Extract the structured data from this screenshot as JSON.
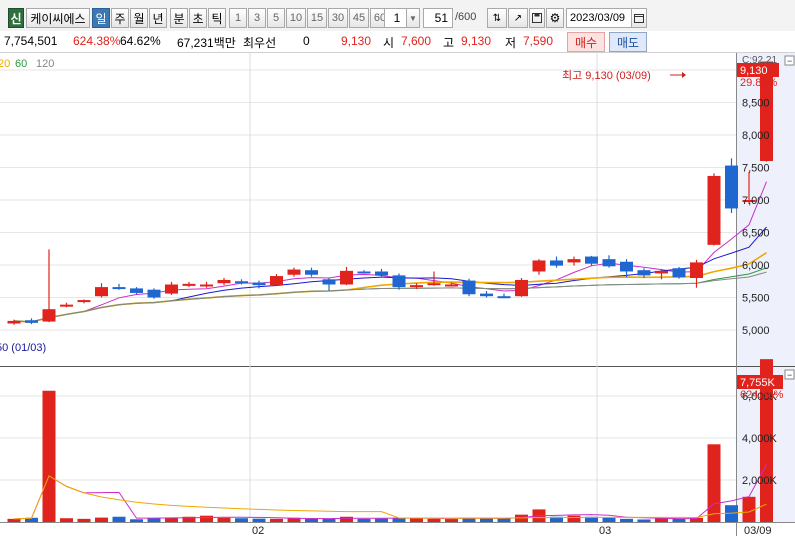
{
  "toolbar": {
    "new_badge": "신",
    "stock_name": "케이씨에스",
    "periods": [
      "일",
      "주",
      "월",
      "년"
    ],
    "unit_labels": [
      "분",
      "초",
      "틱"
    ],
    "intervals": [
      "1",
      "3",
      "5",
      "10",
      "15",
      "30",
      "45",
      "60"
    ],
    "interval_select": "1",
    "count": "51",
    "count_total": "/600",
    "date": "2023/03/09"
  },
  "info": {
    "volume": "7,754,501",
    "volume_change": "624.38%",
    "turnover": "64.62%",
    "amount": "67,231백만",
    "pref_label": "최우선",
    "pref_value": "0",
    "price": "9,130",
    "open_label": "시",
    "open": "7,600",
    "high_label": "고",
    "high": "9,130",
    "low_label": "저",
    "low": "7,590",
    "buy_button": "매수",
    "sell_button": "매도"
  },
  "legend": {
    "ma": [
      "20",
      "60",
      "120"
    ]
  },
  "annotations": {
    "high": "최고 9,130 (03/09)",
    "low": "50 (01/03)",
    "price_tag": "9,130",
    "price_pct": "29.87%",
    "price_top": "C:92.21",
    "volume_tag": "7,755K",
    "volume_pct": "624.38%"
  },
  "colors": {
    "up": "#e0231c",
    "down": "#1f66d1",
    "ma5": "#cc2ccc",
    "ma10": "#1a1acc",
    "ma20": "#f0a800",
    "ma60": "#2a9a3a",
    "ma120": "#888888",
    "panel_bg": "#ffffff",
    "axis_bg": "#eef0fb"
  },
  "chart_data": {
    "type": "candlestick",
    "price_axis": {
      "ticks": [
        "9,000",
        "8,500",
        "8,000",
        "7,500",
        "7,000",
        "6,500",
        "6,000",
        "5,500",
        "5,000"
      ],
      "tick_values": [
        9000,
        8500,
        8000,
        7500,
        7000,
        6500,
        6000,
        5500,
        5000
      ],
      "range": [
        4500,
        9700
      ]
    },
    "volume_axis": {
      "ticks": [
        "6,000K",
        "4,000K",
        "2,000K"
      ],
      "tick_values": [
        6000,
        4000,
        2000
      ],
      "range": [
        0,
        8200
      ]
    },
    "x_labels": [
      "02",
      "03",
      "03/09"
    ],
    "candles": [
      [
        5100,
        5160,
        5080,
        5140
      ],
      [
        5150,
        5180,
        5090,
        5110
      ],
      [
        5130,
        6240,
        5120,
        5320
      ],
      [
        5380,
        5420,
        5350,
        5390
      ],
      [
        5440,
        5470,
        5410,
        5460
      ],
      [
        5520,
        5720,
        5500,
        5660
      ],
      [
        5660,
        5710,
        5620,
        5650
      ],
      [
        5640,
        5660,
        5550,
        5570
      ],
      [
        5620,
        5640,
        5480,
        5500
      ],
      [
        5560,
        5740,
        5540,
        5700
      ],
      [
        5700,
        5740,
        5660,
        5710
      ],
      [
        5690,
        5740,
        5650,
        5700
      ],
      [
        5720,
        5800,
        5690,
        5770
      ],
      [
        5750,
        5780,
        5700,
        5730
      ],
      [
        5730,
        5760,
        5640,
        5690
      ],
      [
        5690,
        5860,
        5680,
        5830
      ],
      [
        5850,
        5960,
        5820,
        5930
      ],
      [
        5920,
        5960,
        5820,
        5850
      ],
      [
        5780,
        5800,
        5600,
        5700
      ],
      [
        5700,
        5970,
        5690,
        5910
      ],
      [
        5900,
        5920,
        5870,
        5890
      ],
      [
        5900,
        5940,
        5820,
        5840
      ],
      [
        5840,
        5870,
        5620,
        5660
      ],
      [
        5680,
        5720,
        5630,
        5690
      ],
      [
        5690,
        5900,
        5680,
        5720
      ],
      [
        5700,
        5730,
        5690,
        5700
      ],
      [
        5760,
        5790,
        5520,
        5550
      ],
      [
        5560,
        5600,
        5500,
        5520
      ],
      [
        5520,
        5560,
        5490,
        5510
      ],
      [
        5520,
        5800,
        5510,
        5770
      ],
      [
        5900,
        6090,
        5850,
        6070
      ],
      [
        6070,
        6130,
        5960,
        5990
      ],
      [
        6040,
        6130,
        5990,
        6090
      ],
      [
        6130,
        6140,
        5990,
        6020
      ],
      [
        6090,
        6150,
        5960,
        5980
      ],
      [
        6050,
        6090,
        5810,
        5900
      ],
      [
        5920,
        5950,
        5800,
        5840
      ],
      [
        5870,
        5940,
        5780,
        5910
      ],
      [
        5950,
        5970,
        5790,
        5810
      ],
      [
        5800,
        6080,
        5650,
        6040
      ],
      [
        6310,
        7410,
        6300,
        7370
      ],
      [
        7530,
        7640,
        6800,
        6870
      ],
      [
        6990,
        7430,
        6940,
        7000
      ],
      [
        7600,
        9130,
        7590,
        9130
      ]
    ],
    "volume": [
      150,
      200,
      6250,
      180,
      150,
      210,
      250,
      130,
      180,
      200,
      250,
      300,
      200,
      180,
      160,
      150,
      200,
      150,
      160,
      250,
      150,
      160,
      200,
      200,
      150,
      140,
      200,
      180,
      180,
      350,
      600,
      250,
      300,
      250,
      200,
      150,
      120,
      180,
      150,
      200,
      3700,
      800,
      1200,
      7755
    ]
  }
}
